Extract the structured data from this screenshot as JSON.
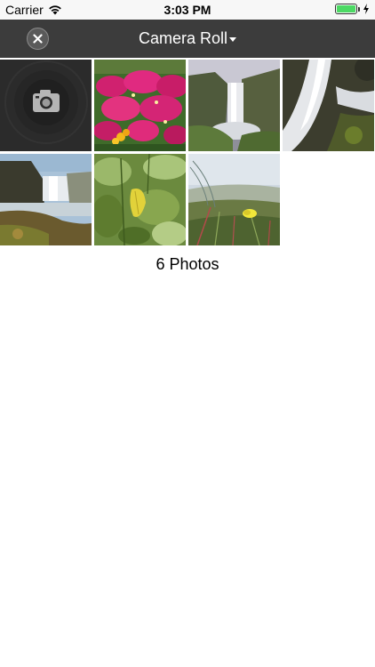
{
  "status_bar": {
    "carrier": "Carrier",
    "time": "3:03 PM",
    "battery_level": 1.0,
    "battery_color": "#4cd964"
  },
  "nav": {
    "close_icon": "close-icon",
    "title": "Camera Roll",
    "dropdown_icon": "chevron-down-icon",
    "background": "#3c3c3c"
  },
  "grid": {
    "camera_tile_icon": "camera-icon",
    "photos": [
      {
        "subject": "pink-flowers"
      },
      {
        "subject": "waterfall-cliff"
      },
      {
        "subject": "waterfall-closeup"
      },
      {
        "subject": "waterfall-coast"
      },
      {
        "subject": "green-leaves"
      },
      {
        "subject": "yellow-flower-grass"
      }
    ]
  },
  "footer": {
    "count_label": "6 Photos"
  }
}
